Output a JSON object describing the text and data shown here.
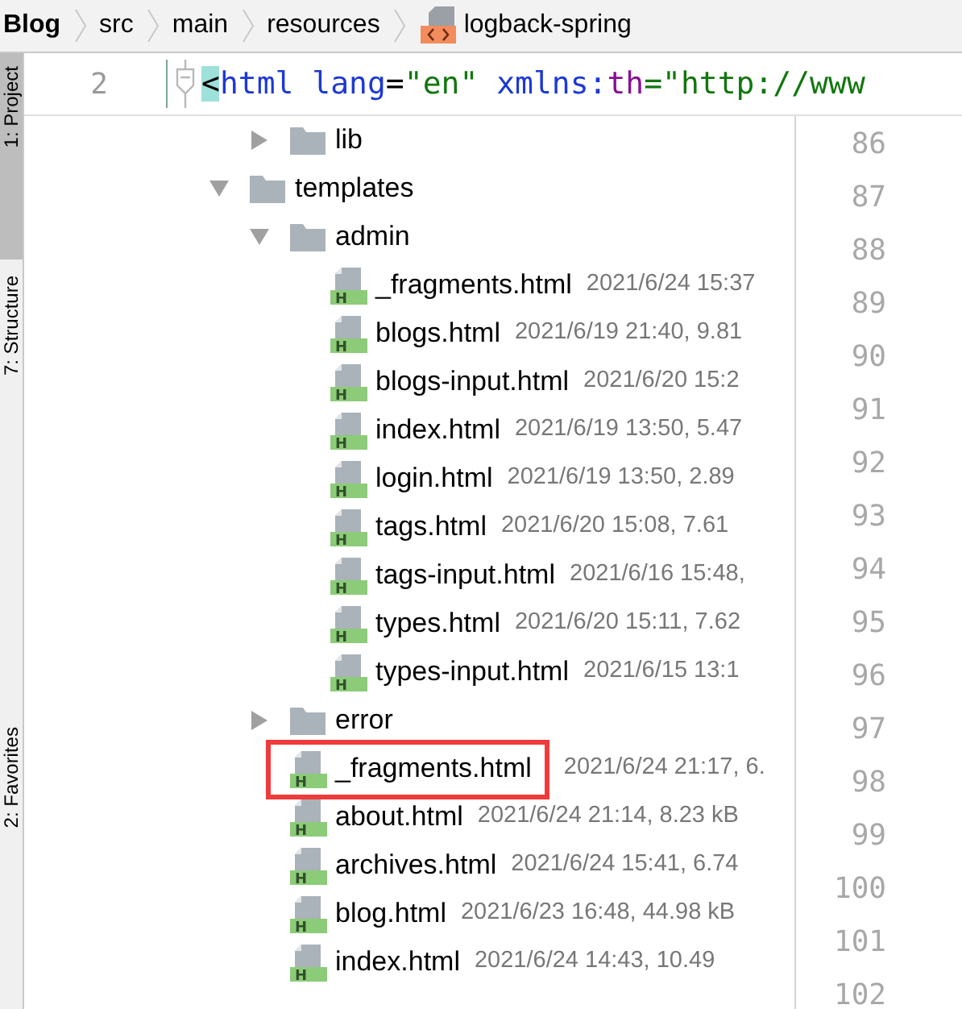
{
  "breadcrumb": [
    {
      "label": "Blog",
      "kind": "project"
    },
    {
      "label": "src",
      "kind": "folder"
    },
    {
      "label": "main",
      "kind": "folder"
    },
    {
      "label": "resources",
      "kind": "folder"
    },
    {
      "label": "logback-spring",
      "kind": "xml"
    }
  ],
  "side_tabs": [
    {
      "label": "1: Project",
      "selected": true
    },
    {
      "label": "7: Structure",
      "selected": false
    },
    {
      "label": "2: Favorites",
      "selected": false
    }
  ],
  "editor_line": {
    "number": "2",
    "tokens": [
      {
        "text": "<",
        "kind": "bracket"
      },
      {
        "text": "html",
        "kind": "tag"
      },
      {
        "text": " lang",
        "kind": "attr"
      },
      {
        "text": "=",
        "kind": "plain"
      },
      {
        "text": "\"en\"",
        "kind": "string"
      },
      {
        "text": " xmlns:",
        "kind": "attr"
      },
      {
        "text": "th",
        "kind": "ns"
      },
      {
        "text": "=\"http://www",
        "kind": "string"
      }
    ]
  },
  "tree": [
    {
      "kind": "group",
      "children": [
        {
          "kind": "folder",
          "name": "lib",
          "expanded": false
        }
      ]
    },
    {
      "kind": "folder",
      "name": "templates",
      "expanded": true,
      "children": [
        {
          "kind": "folder",
          "name": "admin",
          "expanded": true,
          "children": [
            {
              "kind": "file",
              "icon": "H",
              "name": "_fragments.html",
              "meta": "2021/6/24 15:37"
            },
            {
              "kind": "file",
              "icon": "H",
              "name": "blogs.html",
              "meta": "2021/6/19 21:40, 9.81"
            },
            {
              "kind": "file",
              "icon": "H",
              "name": "blogs-input.html",
              "meta": "2021/6/20 15:2"
            },
            {
              "kind": "file",
              "icon": "H",
              "name": "index.html",
              "meta": "2021/6/19 13:50, 5.47"
            },
            {
              "kind": "file",
              "icon": "H",
              "name": "login.html",
              "meta": "2021/6/19 13:50, 2.89"
            },
            {
              "kind": "file",
              "icon": "H",
              "name": "tags.html",
              "meta": "2021/6/20 15:08, 7.61"
            },
            {
              "kind": "file",
              "icon": "H",
              "name": "tags-input.html",
              "meta": "2021/6/16 15:48,"
            },
            {
              "kind": "file",
              "icon": "H",
              "name": "types.html",
              "meta": "2021/6/20 15:11, 7.62"
            },
            {
              "kind": "file",
              "icon": "H",
              "name": "types-input.html",
              "meta": "2021/6/15 13:1"
            }
          ]
        },
        {
          "kind": "folder",
          "name": "error",
          "expanded": false
        },
        {
          "kind": "file",
          "icon": "H",
          "name": "_fragments.html",
          "meta": "2021/6/24 21:17, 6.",
          "highlighted": true
        },
        {
          "kind": "file",
          "icon": "H",
          "name": "about.html",
          "meta": "2021/6/24 21:14, 8.23 kB"
        },
        {
          "kind": "file",
          "icon": "H",
          "name": "archives.html",
          "meta": "2021/6/24 15:41, 6.74"
        },
        {
          "kind": "file",
          "icon": "H",
          "name": "blog.html",
          "meta": "2021/6/23 16:48, 44.98 kB"
        },
        {
          "kind": "file",
          "icon": "H",
          "name": "index.html",
          "meta": "2021/6/24 14:43, 10.49"
        }
      ]
    }
  ],
  "gutter_lines": [
    "86",
    "87",
    "88",
    "89",
    "90",
    "91",
    "92",
    "93",
    "94",
    "95",
    "96",
    "97",
    "98",
    "99",
    "100",
    "101",
    "102"
  ]
}
